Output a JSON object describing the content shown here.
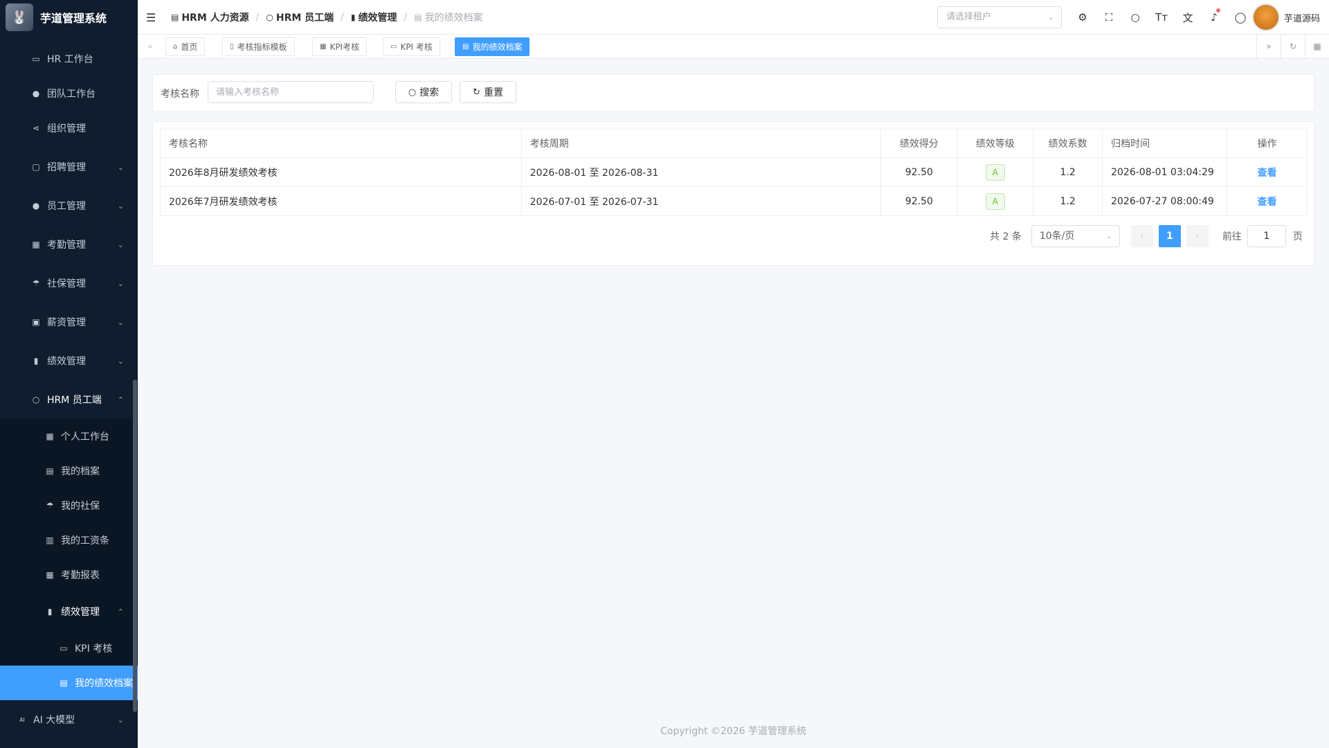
{
  "app": {
    "title": "芋道管理系统",
    "logo_icon": "rabbit-logo"
  },
  "sidebar": {
    "items": [
      {
        "label": "HR 工作台",
        "icon": "monitor-icon",
        "arrow": ""
      },
      {
        "label": "团队工作台",
        "icon": "user-icon",
        "arrow": ""
      },
      {
        "label": "组织管理",
        "icon": "share-icon",
        "arrow": ""
      },
      {
        "label": "招聘管理",
        "icon": "briefcase-icon",
        "arrow": "⌄"
      },
      {
        "label": "员工管理",
        "icon": "user-icon",
        "arrow": "⌄"
      },
      {
        "label": "考勤管理",
        "icon": "calendar-icon",
        "arrow": "⌄"
      },
      {
        "label": "社保管理",
        "icon": "umbrella-icon",
        "arrow": "⌄"
      },
      {
        "label": "薪资管理",
        "icon": "wallet-icon",
        "arrow": "⌄"
      },
      {
        "label": "绩效管理",
        "icon": "bar-chart-icon",
        "arrow": "⌄"
      },
      {
        "label": "HRM 员工端",
        "icon": "user-outline-icon",
        "arrow": "⌃"
      },
      {
        "label": "个人工作台",
        "icon": "calendar-icon",
        "arrow": ""
      },
      {
        "label": "我的档案",
        "icon": "book-icon",
        "arrow": ""
      },
      {
        "label": "我的社保",
        "icon": "umbrella-icon",
        "arrow": ""
      },
      {
        "label": "我的工资条",
        "icon": "document-icon",
        "arrow": ""
      },
      {
        "label": "考勤报表",
        "icon": "calendar-icon",
        "arrow": ""
      },
      {
        "label": "绩效管理",
        "icon": "bar-chart-icon",
        "arrow": "⌃"
      },
      {
        "label": "KPI 考核",
        "icon": "monitor-icon",
        "arrow": ""
      },
      {
        "label": "我的绩效档案",
        "icon": "book-icon",
        "arrow": ""
      },
      {
        "label": "AI 大模型",
        "icon": "ai-icon",
        "arrow": "⌄"
      }
    ]
  },
  "header": {
    "breadcrumb": [
      "HRM 人力资源",
      "HRM 员工端",
      "绩效管理",
      "我的绩效档案"
    ],
    "tenant_placeholder": "请选择租户",
    "username": "芋道源码"
  },
  "tabs": [
    {
      "label": "首页",
      "icon": "home-icon"
    },
    {
      "label": "考核指标模板",
      "icon": "document-icon"
    },
    {
      "label": "KPI考核",
      "icon": "calendar-icon"
    },
    {
      "label": "KPI 考核",
      "icon": "monitor-icon"
    },
    {
      "label": "我的绩效档案",
      "icon": "book-icon"
    }
  ],
  "search": {
    "label": "考核名称",
    "placeholder": "请输入考核名称",
    "search_button": "搜索",
    "reset_button": "重置"
  },
  "table": {
    "columns": [
      "考核名称",
      "考核周期",
      "绩效得分",
      "绩效等级",
      "绩效系数",
      "归档时间",
      "操作"
    ],
    "rows": [
      {
        "name": "2026年8月研发绩效考核",
        "period": "2026-08-01 至 2026-08-31",
        "score": "92.50",
        "grade": "A",
        "coef": "1.2",
        "archived": "2026-08-01 03:04:29",
        "action": "查看"
      },
      {
        "name": "2026年7月研发绩效考核",
        "period": "2026-07-01 至 2026-07-31",
        "score": "92.50",
        "grade": "A",
        "coef": "1.2",
        "archived": "2026-07-27 08:00:49",
        "action": "查看"
      }
    ]
  },
  "pagination": {
    "total": "共 2 条",
    "page_size": "10条/页",
    "current": "1",
    "goto_label": "前往",
    "goto_value": "1",
    "page_suffix": "页"
  },
  "footer": {
    "text": "Copyright ©2026 芋道管理系统"
  },
  "colors": {
    "accent": "#409eff",
    "sidebar_bg": "#0f1d2e",
    "grade_green": "#67c23a"
  }
}
